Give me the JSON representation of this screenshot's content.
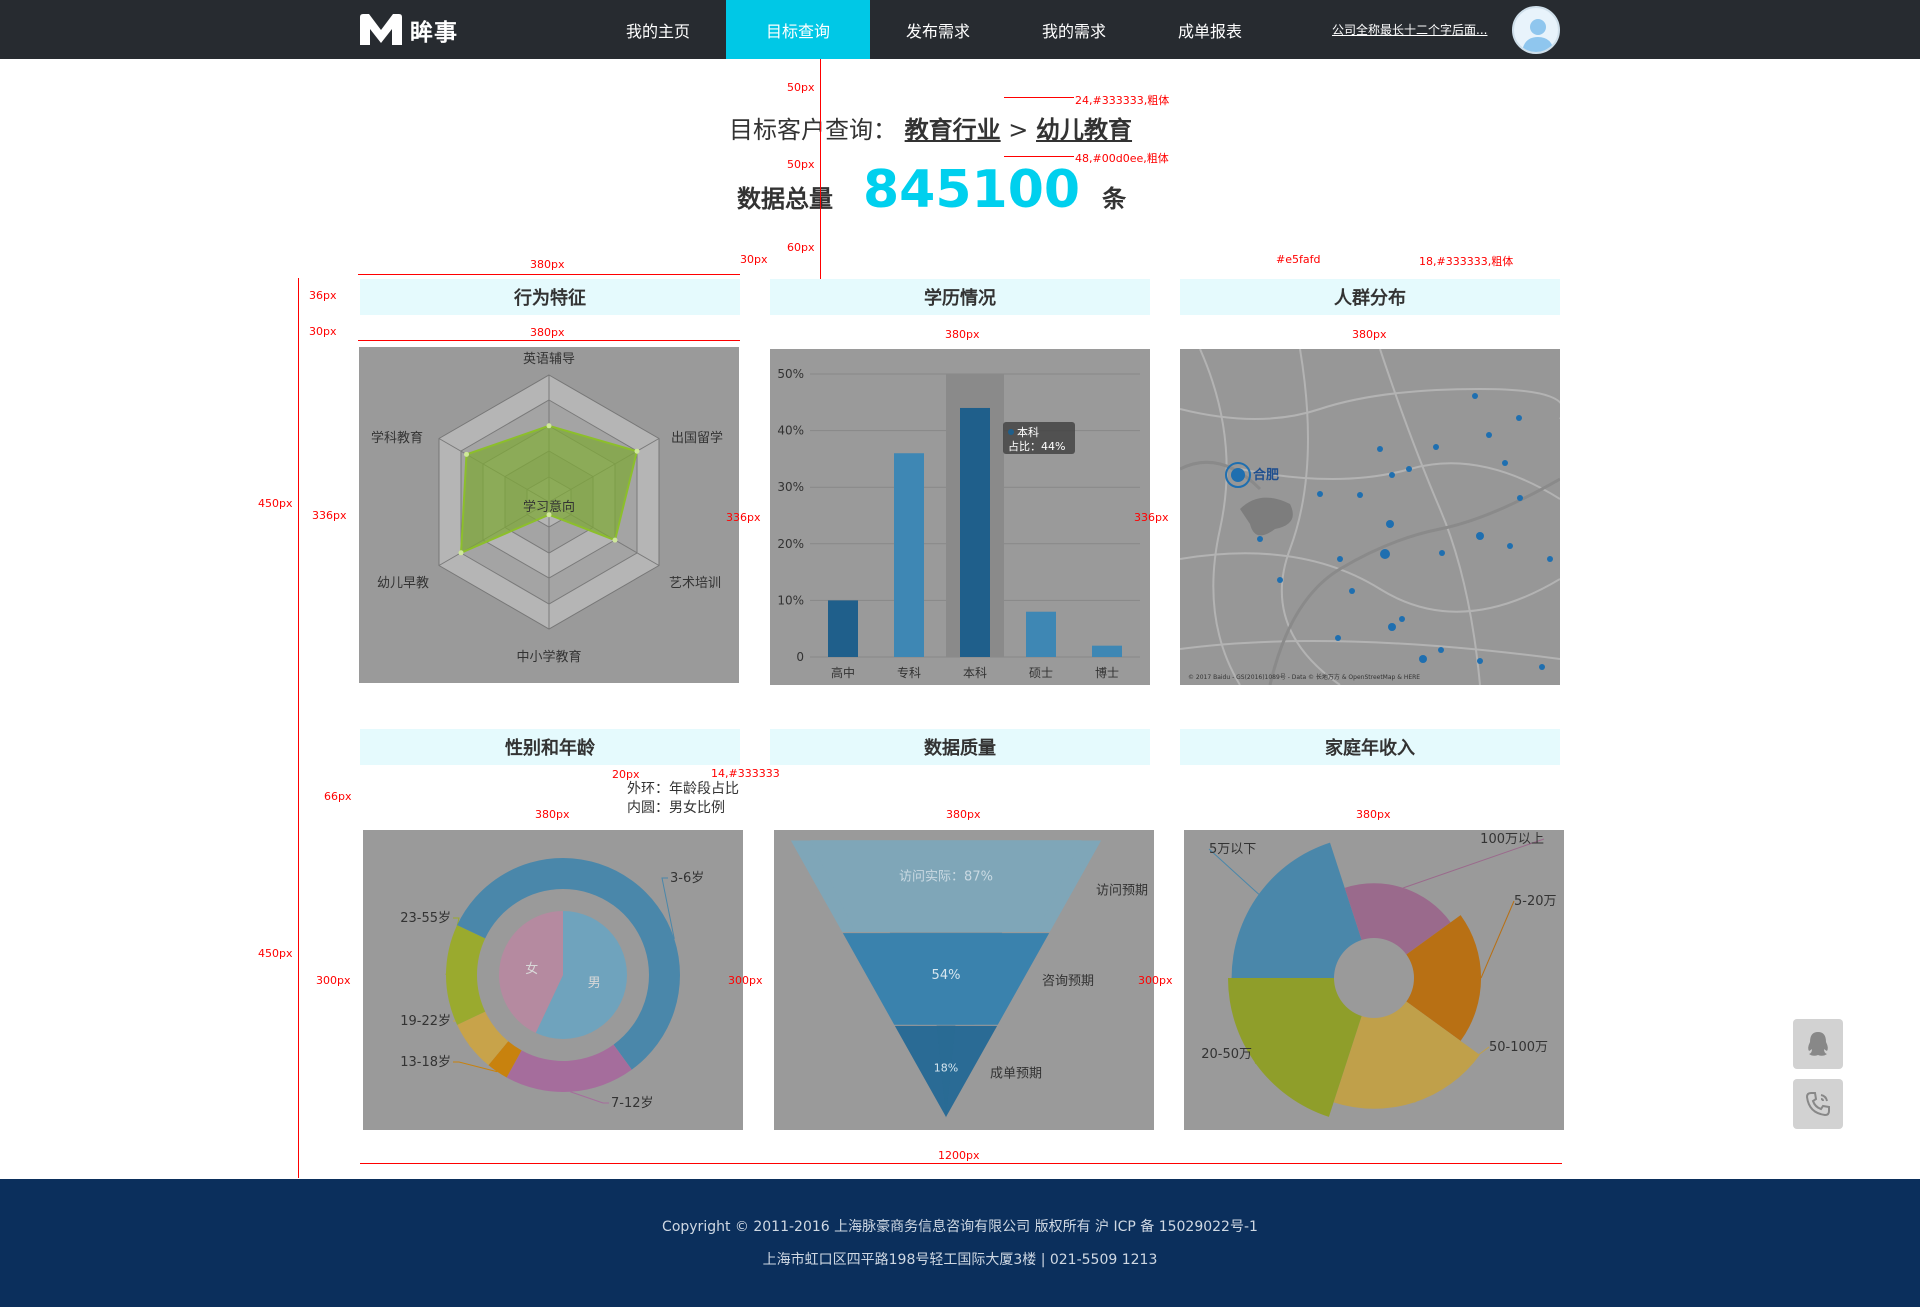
{
  "header": {
    "logo_text": "眸事",
    "nav": [
      "我的主页",
      "目标查询",
      "发布需求",
      "我的需求",
      "成单报表"
    ],
    "active_index": 1,
    "company": "公司全称最长十二个字后面..."
  },
  "query": {
    "prefix": "目标客户查询：",
    "industry": "教育行业",
    "separator": ">",
    "sub": "幼儿教育"
  },
  "total": {
    "label": "数据总量",
    "value": "845100",
    "unit": "条"
  },
  "panels": {
    "behavior": "行为特征",
    "education": "学历情况",
    "crowd": "人群分布",
    "gender_age": "性别和年龄",
    "quality": "数据质量",
    "income": "家庭年收入"
  },
  "note": {
    "line1": "外环：年龄段占比",
    "line2": "内圆：男女比例"
  },
  "annotations": {
    "a50a": "50px",
    "a50b": "50px",
    "a60": "60px",
    "a36": "36px",
    "a30": "30px",
    "a30b": "30px",
    "a380": "380px",
    "a336": "336px",
    "a450": "450px",
    "a66": "66px",
    "a20": "20px",
    "a300": "300px",
    "a1200": "1200px",
    "spec_title": "24,#333333,粗体",
    "spec_num": "48,#00d0ee,粗体",
    "spec_bg": "#e5fafd",
    "spec_head": "18,#333333,粗体",
    "spec_note": "14,#333333"
  },
  "chart_data": [
    {
      "type": "radar",
      "center_label": "学习意向",
      "categories": [
        "英语辅导",
        "出国留学",
        "艺术培训",
        "中小学教育",
        "幼儿早教",
        "学科教育"
      ],
      "values": [
        0.6,
        0.8,
        0.6,
        0.1,
        0.8,
        0.75
      ],
      "max": 1
    },
    {
      "type": "bar",
      "categories": [
        "高中",
        "专科",
        "本科",
        "硕士",
        "博士"
      ],
      "values": [
        10,
        36,
        44,
        8,
        2
      ],
      "ylim": [
        0,
        50
      ],
      "yticks": [
        "0",
        "10%",
        "20%",
        "30%",
        "40%",
        "50%"
      ],
      "tooltip": {
        "name": "本科",
        "text": "占比：44%"
      }
    },
    {
      "type": "map",
      "city": "合肥",
      "copyright": "© 2017 Baidu - GS(2016)1089号 - Data © 长地万方 & OpenStreetMap & HERE"
    },
    {
      "type": "pie",
      "outer": [
        {
          "name": "3-6岁",
          "value": 40
        },
        {
          "name": "7-12岁",
          "value": 18
        },
        {
          "name": "13-18岁",
          "value": 3
        },
        {
          "name": "19-22岁",
          "value": 7
        },
        {
          "name": "23-55岁",
          "value": 14
        },
        {
          "name": "",
          "value": 18
        }
      ],
      "inner": [
        {
          "name": "女",
          "value": 43
        },
        {
          "name": "男",
          "value": 57
        }
      ]
    },
    {
      "type": "funnel",
      "stages": [
        {
          "name": "访问预期",
          "label": "访问实际：87%",
          "value": 87
        },
        {
          "name": "咨询预期",
          "label": "54%",
          "value": 54
        },
        {
          "name": "成单预期",
          "label": "18%",
          "value": 18
        }
      ]
    },
    {
      "type": "pie",
      "roseType": "area",
      "series": [
        {
          "name": "5万以下",
          "value": 28
        },
        {
          "name": "100万以上",
          "value": 8
        },
        {
          "name": "5-20万",
          "value": 12
        },
        {
          "name": "50-100万",
          "value": 22
        },
        {
          "name": "20-50万",
          "value": 30
        }
      ]
    }
  ],
  "footer": {
    "line1": "Copyright  ©   2011-2016 上海脉豪商务信息咨询有限公司  版权所有  沪 ICP 备 15029022号-1",
    "line2": "上海市虹口区四平路198号轻工国际大厦3楼  |  021-5509 1213"
  }
}
